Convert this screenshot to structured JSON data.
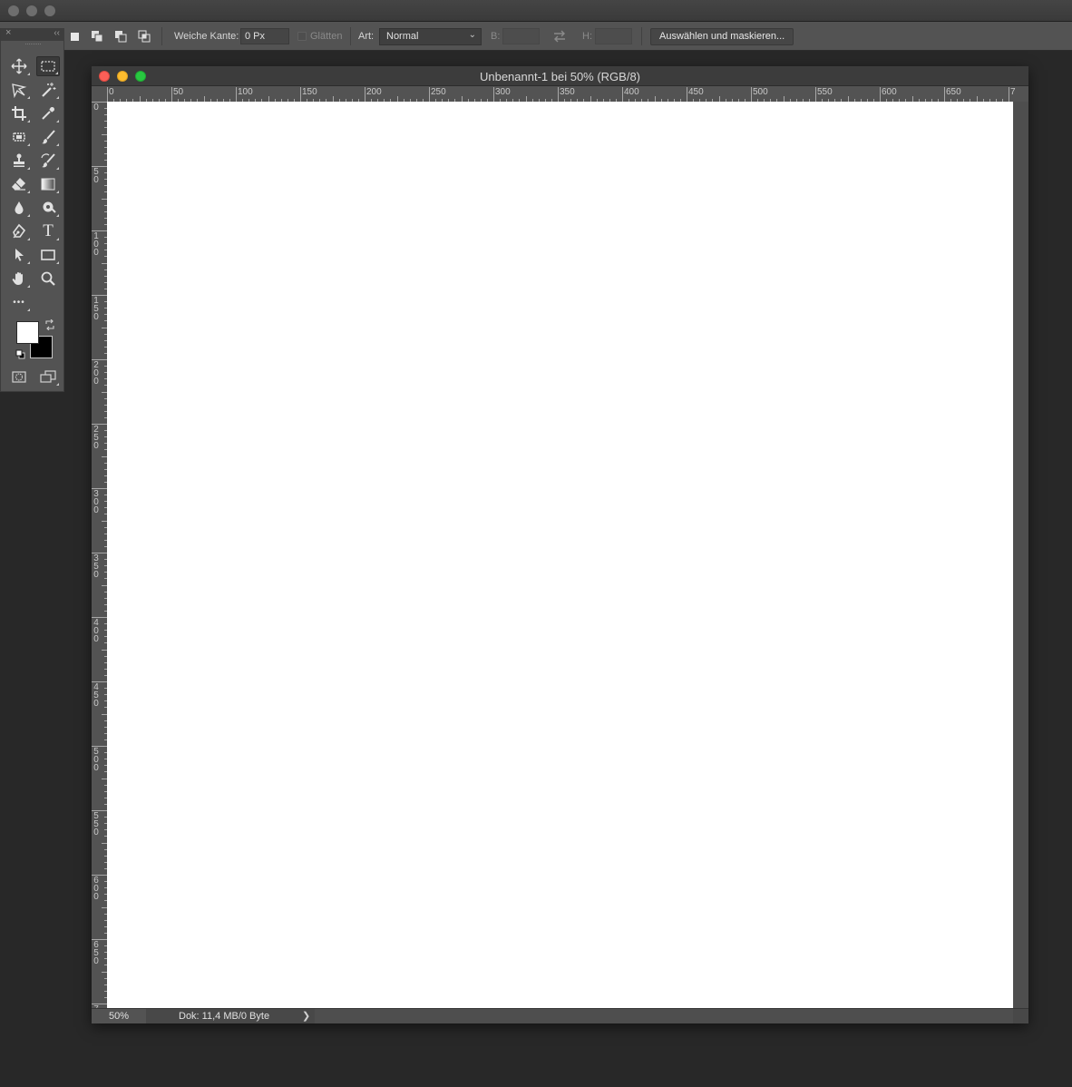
{
  "options_bar": {
    "feather_label": "Weiche Kante:",
    "feather_value": "0 Px",
    "antialias_label": "Glätten",
    "style_label": "Art:",
    "style_value": "Normal",
    "width_label": "B:",
    "height_label": "H:",
    "select_mask_button": "Auswählen und maskieren..."
  },
  "tools_panel": {
    "close_glyph": "×",
    "collapse_glyph": "‹‹",
    "tools": [
      {
        "name": "move-tool",
        "icon": "move-icon"
      },
      {
        "name": "rectangular-marquee-tool",
        "icon": "marquee-icon",
        "active": true
      },
      {
        "name": "lasso-tool",
        "icon": "lasso-icon"
      },
      {
        "name": "magic-wand-tool",
        "icon": "magic-wand-icon"
      },
      {
        "name": "crop-tool",
        "icon": "crop-icon"
      },
      {
        "name": "eyedropper-tool",
        "icon": "eyedropper-icon"
      },
      {
        "name": "spot-healing-tool",
        "icon": "healing-icon"
      },
      {
        "name": "brush-tool",
        "icon": "brush-icon"
      },
      {
        "name": "clone-stamp-tool",
        "icon": "stamp-icon"
      },
      {
        "name": "history-brush-tool",
        "icon": "history-brush-icon"
      },
      {
        "name": "eraser-tool",
        "icon": "eraser-icon"
      },
      {
        "name": "gradient-tool",
        "icon": "gradient-icon"
      },
      {
        "name": "blur-tool",
        "icon": "blur-icon"
      },
      {
        "name": "dodge-tool",
        "icon": "dodge-icon"
      },
      {
        "name": "pen-tool",
        "icon": "pen-icon"
      },
      {
        "name": "type-tool",
        "icon": "type-icon"
      },
      {
        "name": "path-selection-tool",
        "icon": "path-selection-icon"
      },
      {
        "name": "rectangle-tool",
        "icon": "rectangle-icon"
      },
      {
        "name": "hand-tool",
        "icon": "hand-icon"
      },
      {
        "name": "zoom-tool",
        "icon": "zoom-icon"
      },
      {
        "name": "edit-toolbar",
        "icon": "more-icon"
      }
    ],
    "foreground_color": "#ffffff",
    "background_color": "#000000",
    "type_glyph": "T",
    "more_glyph": "•••"
  },
  "document": {
    "title": "Unbenannt-1 bei 50% (RGB/8)",
    "zoom": "50%",
    "doc_info": "Dok: 11,4 MB/0 Byte",
    "status_arrow": "❯",
    "ruler_h_labels": [
      "0",
      "50",
      "100",
      "150",
      "200",
      "250",
      "300",
      "350",
      "400",
      "450",
      "500",
      "550",
      "600",
      "650",
      "7"
    ],
    "ruler_v_labels": [
      "0",
      "50",
      "100",
      "150",
      "200",
      "250",
      "300",
      "350",
      "400",
      "450",
      "500",
      "550",
      "600",
      "650",
      "7"
    ]
  }
}
